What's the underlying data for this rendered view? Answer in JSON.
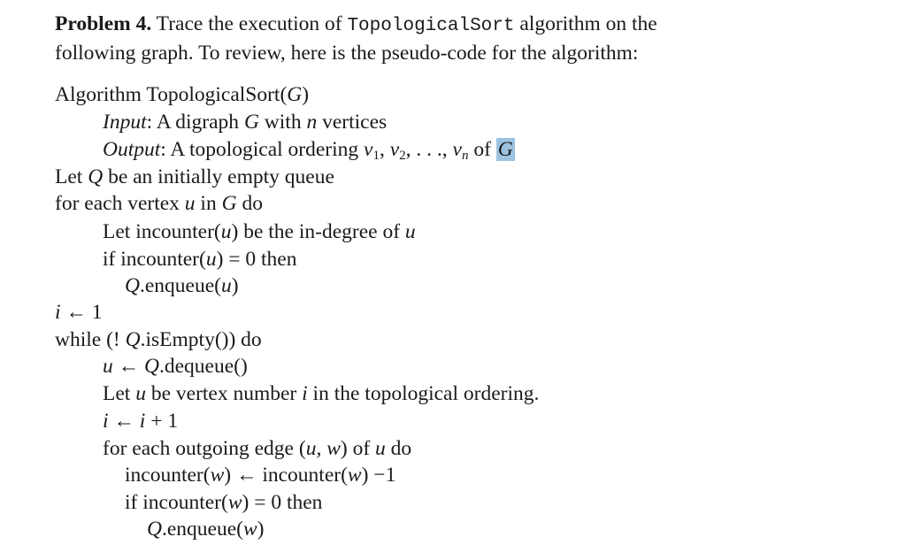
{
  "problem": {
    "label": "Problem 4.",
    "intro_part1": "Trace the execution of",
    "algorithm_code_name": "TopologicalSort",
    "intro_part2": "algorithm on the",
    "intro_line2": "following graph. To review, here is the pseudo-code for the algorithm:"
  },
  "algorithm": {
    "header": "Algorithm TopologicalSort(",
    "header_arg": "G",
    "header_close": ")",
    "input_label": "Input",
    "input_text_a": ": A digraph ",
    "input_var_g": "G",
    "input_text_b": " with ",
    "input_var_n": "n",
    "input_text_c": " vertices",
    "output_label": "Output",
    "output_text_a": ": A topological ordering ",
    "output_v": "v",
    "output_sub1": "1",
    "output_sep": ", ",
    "output_sub2": "2",
    "output_ellipsis": ", . . ., ",
    "output_subn": "n",
    "output_text_b": " of ",
    "output_highlight": "G",
    "lines": [
      {
        "a": "Let ",
        "v": "Q",
        "b": " be an initially empty queue"
      },
      {
        "a": "for each vertex ",
        "v": "u",
        "b": " in ",
        "v2": "G",
        "c": " do"
      },
      {
        "a": "Let incounter(",
        "v": "u",
        "b": ") be the in-degree of ",
        "v2": "u",
        "c": ""
      },
      {
        "a": "if incounter(",
        "v": "u",
        "b": ") = 0 then"
      },
      {
        "a": "",
        "v": "Q",
        "b": ".enqueue(",
        "v2": "u",
        "c": ")"
      },
      {
        "a": "",
        "v": "i",
        "b": " ← 1"
      },
      {
        "a": "while (! ",
        "v": "Q",
        "b": ".isEmpty()) do"
      },
      {
        "a": "",
        "v": "u",
        "b": " ← ",
        "v2": "Q",
        "c": ".dequeue()"
      },
      {
        "a": "Let ",
        "v": "u",
        "b": " be vertex number ",
        "v2": "i",
        "c": " in the topological ordering."
      },
      {
        "a": "",
        "v": "i",
        "b": " ← ",
        "v2": "i",
        "c": " + 1"
      },
      {
        "a": "for each outgoing edge (",
        "v": "u, w",
        "b": ") of ",
        "v2": "u",
        "c": " do"
      },
      {
        "a": "incounter(",
        "v": "w",
        "b": ") ← incounter(",
        "v2": "w",
        "c": ") −1"
      },
      {
        "a": "if incounter(",
        "v": "w",
        "b": ") = 0 then"
      },
      {
        "a": "",
        "v": "Q",
        "b": ".enqueue(",
        "v2": "w",
        "c": ")"
      }
    ]
  },
  "colors": {
    "selection_highlight": "#9cc2e0",
    "text": "#1a1a1a"
  }
}
